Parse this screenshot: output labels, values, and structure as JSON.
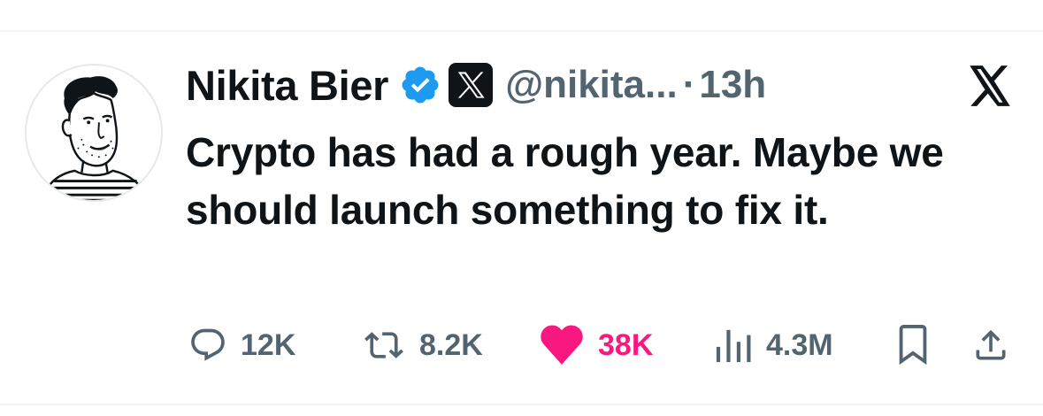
{
  "author": {
    "display_name": "Nikita Bier",
    "handle": "@nikita...",
    "separator": "·",
    "timestamp": "13h",
    "verified_icon": "verified-badge-icon",
    "affiliate_icon": "x-affiliate-icon"
  },
  "platform_logo": "x-logo-icon",
  "tweet": {
    "text": "Crypto has had a rough year. Maybe we should launch something to fix it."
  },
  "actions": {
    "replies": "12K",
    "retweets": "8.2K",
    "likes": "38K",
    "views": "4.3M"
  },
  "colors": {
    "text": "#0f1419",
    "secondary": "#536471",
    "verified_blue": "#1d9bf0",
    "like_pink": "#f91880",
    "divider": "#eff3f4"
  }
}
